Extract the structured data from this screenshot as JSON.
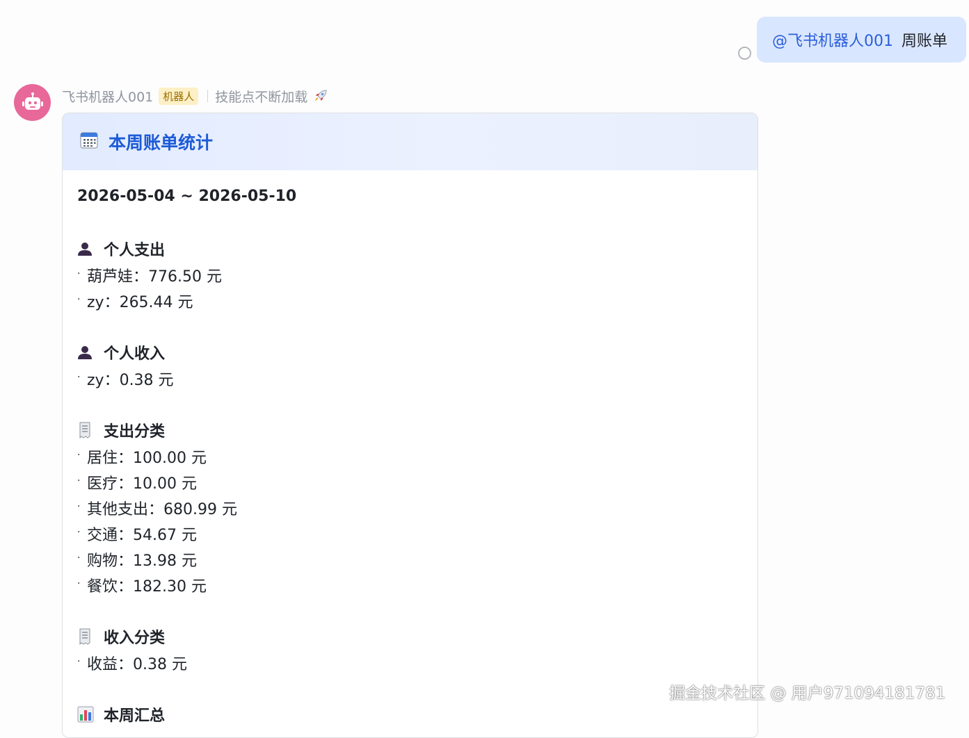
{
  "outgoing_message": {
    "mention": "@飞书机器人001",
    "text": "周账单"
  },
  "sender": {
    "name": "飞书机器人001",
    "badge": "机器人",
    "signature": "技能点不断加载"
  },
  "card": {
    "title": "本周账单统计",
    "date_range": "2026-05-04 ~ 2026-05-10",
    "sections": [
      {
        "icon": "person-icon",
        "title": "个人支出",
        "items": [
          "葫芦娃：776.50 元",
          "zy：265.44 元"
        ]
      },
      {
        "icon": "person-icon",
        "title": "个人收入",
        "items": [
          "zy：0.38 元"
        ]
      },
      {
        "icon": "receipt-icon",
        "title": "支出分类",
        "items": [
          "居住：100.00 元",
          "医疗：10.00 元",
          "其他支出：680.99 元",
          "交通：54.67 元",
          "购物：13.98 元",
          "餐饮：182.30 元"
        ]
      },
      {
        "icon": "receipt-icon",
        "title": "收入分类",
        "items": [
          "收益：0.38 元"
        ]
      },
      {
        "icon": "bar-chart-icon",
        "title": "本周汇总",
        "items": []
      }
    ]
  },
  "watermark": "掘金技术社区 @ 用户971094181781",
  "colors": {
    "accent": "#1d5bd6",
    "bubble": "#d9e6ff",
    "avatar": "#e8689a",
    "badge_bg": "#fdf0c6"
  }
}
